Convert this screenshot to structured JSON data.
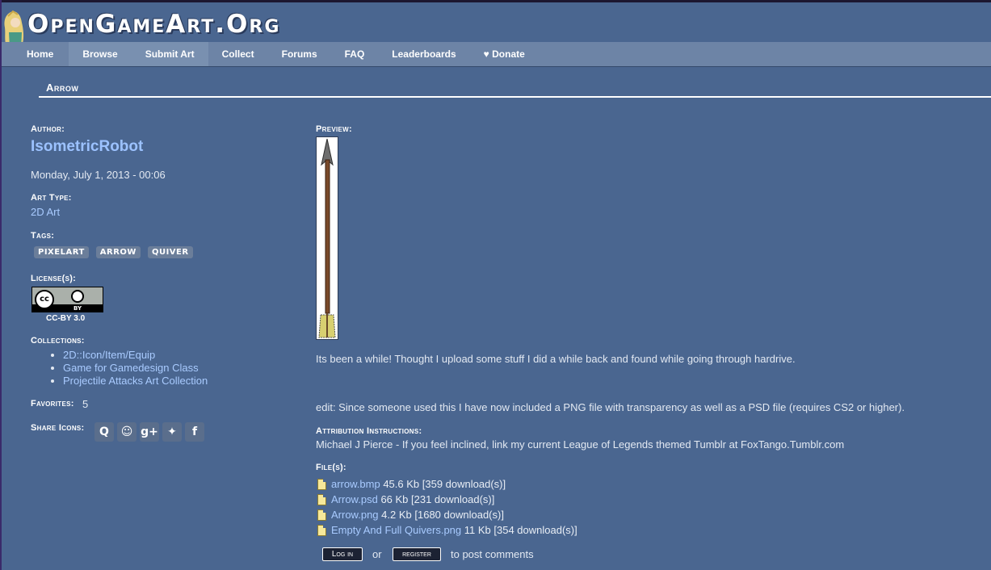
{
  "site": {
    "name": "OpenGameArt.Org"
  },
  "nav": [
    {
      "label": "Home"
    },
    {
      "label": "Browse"
    },
    {
      "label": "Submit Art"
    },
    {
      "label": "Collect"
    },
    {
      "label": "Forums"
    },
    {
      "label": "FAQ"
    },
    {
      "label": "Leaderboards"
    },
    {
      "label": "♥ Donate"
    }
  ],
  "page": {
    "title": "Arrow"
  },
  "sidebar": {
    "author_label": "Author:",
    "author": "IsometricRobot",
    "date": "Monday, July 1, 2013 - 00:06",
    "art_type_label": "Art Type:",
    "art_type": "2D Art",
    "tags_label": "Tags:",
    "tags": [
      "PIXELART",
      "ARROW",
      "QUIVER"
    ],
    "license_label": "License(s):",
    "license_badge": {
      "cc": "cc",
      "by": "BY"
    },
    "license": "CC-BY 3.0",
    "collections_label": "Collections:",
    "collections": [
      "2D::Icon/Item/Equip",
      "Game for Gamedesign Class",
      "Projectile Attacks Art Collection"
    ],
    "favorites_label": "Favorites:",
    "favorites": "5",
    "share_label": "Share Icons:",
    "share_icons": [
      {
        "name": "chat-icon",
        "glyph": "Q"
      },
      {
        "name": "reddit-icon",
        "glyph": "☺"
      },
      {
        "name": "google-plus-icon",
        "glyph": "g+"
      },
      {
        "name": "twitter-icon",
        "glyph": "✦"
      },
      {
        "name": "facebook-icon",
        "glyph": "f"
      }
    ]
  },
  "main": {
    "preview_label": "Preview:",
    "desc1": "Its been a while! Thought I upload some stuff I did a while back and found while going through hardrive.",
    "desc2": "edit: Since someone used this I have now included a PNG file with transparency as well as a PSD file (requires CS2 or higher).",
    "attribution_label": "Attribution Instructions:",
    "attribution": "Michael J Pierce - If you feel inclined, link my current League of Legends themed Tumblr at FoxTango.Tumblr.com",
    "files_label": "File(s):",
    "files": [
      {
        "name": "arrow.bmp",
        "info": "45.6 Kb [359 download(s)]"
      },
      {
        "name": "Arrow.psd",
        "info": "66 Kb [231 download(s)]"
      },
      {
        "name": "Arrow.png",
        "info": "4.2 Kb [1680 download(s)]"
      },
      {
        "name": "Empty And Full Quivers.png",
        "info": "11 Kb [354 download(s)]"
      }
    ],
    "login_label": "Log in",
    "or_text": "or",
    "register_label": "register",
    "post_text": "to post comments"
  }
}
